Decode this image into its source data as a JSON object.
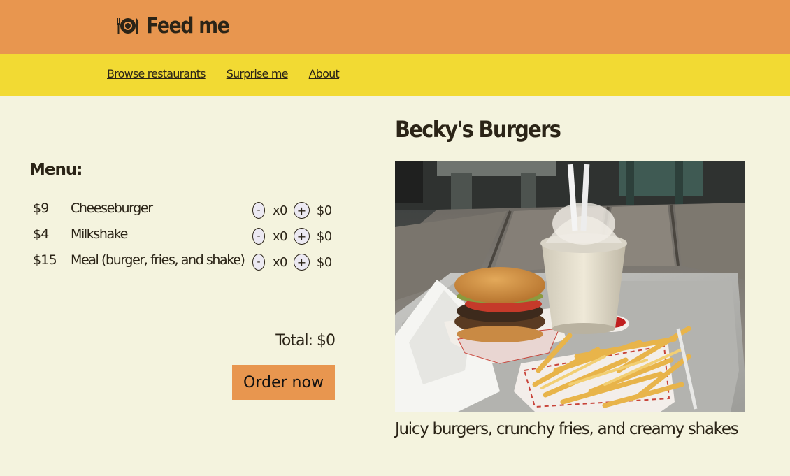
{
  "brand": {
    "icon": "plate-and-cutlery-icon",
    "title": "Feed me"
  },
  "nav": {
    "links": [
      "Browse restaurants",
      "Surprise me",
      "About"
    ]
  },
  "menu": {
    "heading": "Menu:",
    "items": [
      {
        "price": "$9",
        "name": "Cheeseburger",
        "minus": "-",
        "qty": "x0",
        "plus": "+",
        "line_total": "$0"
      },
      {
        "price": "$4",
        "name": "Milkshake",
        "minus": "-",
        "qty": "x0",
        "plus": "+",
        "line_total": "$0"
      },
      {
        "price": "$15",
        "name": "Meal (burger, fries, and shake)",
        "minus": "-",
        "qty": "x0",
        "plus": "+",
        "line_total": "$0"
      }
    ],
    "total": "Total: $0",
    "order_button": "Order now"
  },
  "restaurant": {
    "name": "Becky's Burgers",
    "photo_alt": "burger-fries-shake-photo",
    "caption": "Juicy burgers, crunchy fries, and creamy shakes"
  },
  "colors": {
    "header": "#e8964f",
    "nav": "#f2da33",
    "background": "#f4f3de",
    "button": "#e8964f",
    "text": "#2b2417"
  }
}
